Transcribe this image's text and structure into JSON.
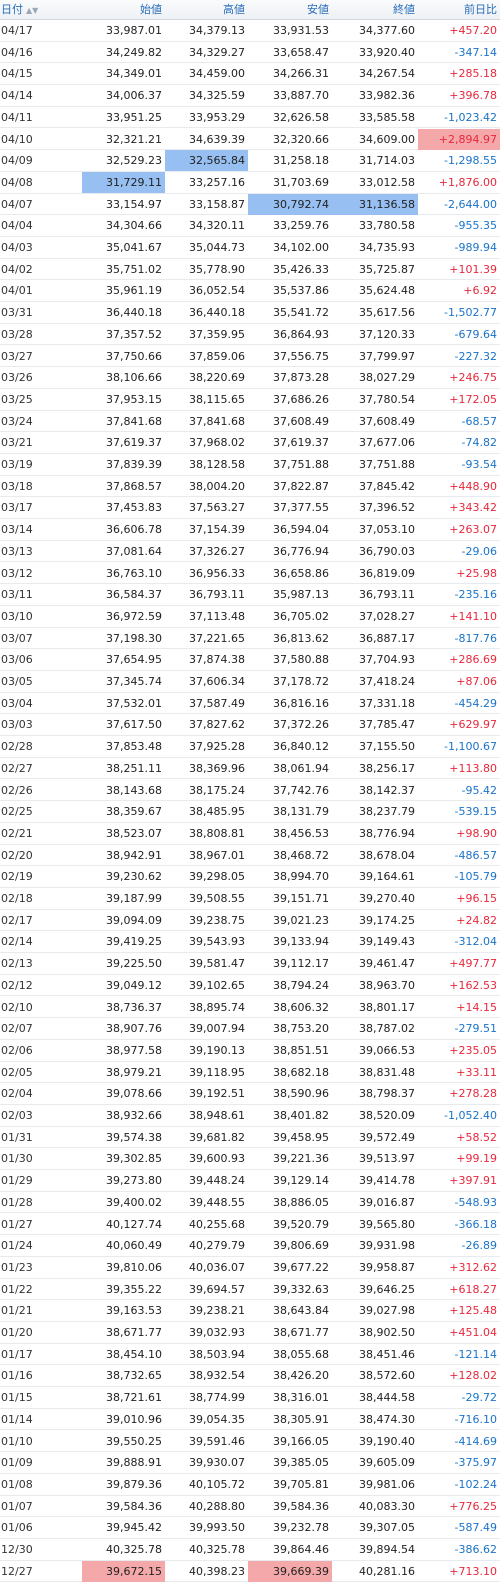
{
  "header": {
    "date": "日付",
    "open": "始値",
    "high": "高値",
    "low": "安値",
    "close": "終値",
    "change": "前日比"
  },
  "colors": {
    "positive": "#e8283c",
    "negative": "#1a73c8",
    "highlight_blue": "#97bff2",
    "highlight_red": "#f5a8aa"
  },
  "rows": [
    [
      "04/17",
      "33,987.01",
      "34,379.13",
      "33,931.53",
      "34,377.60",
      "+457.20"
    ],
    [
      "04/16",
      "34,249.82",
      "34,329.27",
      "33,658.47",
      "33,920.40",
      "-347.14"
    ],
    [
      "04/15",
      "34,349.01",
      "34,459.00",
      "34,266.31",
      "34,267.54",
      "+285.18"
    ],
    [
      "04/14",
      "34,006.37",
      "34,325.59",
      "33,887.70",
      "33,982.36",
      "+396.78"
    ],
    [
      "04/11",
      "33,951.25",
      "33,953.29",
      "32,626.58",
      "33,585.58",
      "-1,023.42"
    ],
    [
      "04/10",
      "32,321.21",
      "34,639.39",
      "32,320.66",
      "34,609.00",
      "+2,894.97"
    ],
    [
      "04/09",
      "32,529.23",
      "32,565.84",
      "31,258.18",
      "31,714.03",
      "-1,298.55"
    ],
    [
      "04/08",
      "31,729.11",
      "33,257.16",
      "31,703.69",
      "33,012.58",
      "+1,876.00"
    ],
    [
      "04/07",
      "33,154.97",
      "33,158.87",
      "30,792.74",
      "31,136.58",
      "-2,644.00"
    ],
    [
      "04/04",
      "34,304.66",
      "34,320.11",
      "33,259.76",
      "33,780.58",
      "-955.35"
    ],
    [
      "04/03",
      "35,041.67",
      "35,044.73",
      "34,102.00",
      "34,735.93",
      "-989.94"
    ],
    [
      "04/02",
      "35,751.02",
      "35,778.90",
      "35,426.33",
      "35,725.87",
      "+101.39"
    ],
    [
      "04/01",
      "35,961.19",
      "36,052.54",
      "35,537.86",
      "35,624.48",
      "+6.92"
    ],
    [
      "03/31",
      "36,440.18",
      "36,440.18",
      "35,541.72",
      "35,617.56",
      "-1,502.77"
    ],
    [
      "03/28",
      "37,357.52",
      "37,359.95",
      "36,864.93",
      "37,120.33",
      "-679.64"
    ],
    [
      "03/27",
      "37,750.66",
      "37,859.06",
      "37,556.75",
      "37,799.97",
      "-227.32"
    ],
    [
      "03/26",
      "38,106.66",
      "38,220.69",
      "37,873.28",
      "38,027.29",
      "+246.75"
    ],
    [
      "03/25",
      "37,953.15",
      "38,115.65",
      "37,686.26",
      "37,780.54",
      "+172.05"
    ],
    [
      "03/24",
      "37,841.68",
      "37,841.68",
      "37,608.49",
      "37,608.49",
      "-68.57"
    ],
    [
      "03/21",
      "37,619.37",
      "37,968.02",
      "37,619.37",
      "37,677.06",
      "-74.82"
    ],
    [
      "03/19",
      "37,839.39",
      "38,128.58",
      "37,751.88",
      "37,751.88",
      "-93.54"
    ],
    [
      "03/18",
      "37,868.57",
      "38,004.20",
      "37,822.87",
      "37,845.42",
      "+448.90"
    ],
    [
      "03/17",
      "37,453.83",
      "37,563.27",
      "37,377.55",
      "37,396.52",
      "+343.42"
    ],
    [
      "03/14",
      "36,606.78",
      "37,154.39",
      "36,594.04",
      "37,053.10",
      "+263.07"
    ],
    [
      "03/13",
      "37,081.64",
      "37,326.27",
      "36,776.94",
      "36,790.03",
      "-29.06"
    ],
    [
      "03/12",
      "36,763.10",
      "36,956.33",
      "36,658.86",
      "36,819.09",
      "+25.98"
    ],
    [
      "03/11",
      "36,584.37",
      "36,793.11",
      "35,987.13",
      "36,793.11",
      "-235.16"
    ],
    [
      "03/10",
      "36,972.59",
      "37,113.48",
      "36,705.02",
      "37,028.27",
      "+141.10"
    ],
    [
      "03/07",
      "37,198.30",
      "37,221.65",
      "36,813.62",
      "36,887.17",
      "-817.76"
    ],
    [
      "03/06",
      "37,654.95",
      "37,874.38",
      "37,580.88",
      "37,704.93",
      "+286.69"
    ],
    [
      "03/05",
      "37,345.74",
      "37,606.34",
      "37,178.72",
      "37,418.24",
      "+87.06"
    ],
    [
      "03/04",
      "37,532.01",
      "37,587.49",
      "36,816.16",
      "37,331.18",
      "-454.29"
    ],
    [
      "03/03",
      "37,617.50",
      "37,827.62",
      "37,372.26",
      "37,785.47",
      "+629.97"
    ],
    [
      "02/28",
      "37,853.48",
      "37,925.28",
      "36,840.12",
      "37,155.50",
      "-1,100.67"
    ],
    [
      "02/27",
      "38,251.11",
      "38,369.96",
      "38,061.94",
      "38,256.17",
      "+113.80"
    ],
    [
      "02/26",
      "38,143.68",
      "38,175.24",
      "37,742.76",
      "38,142.37",
      "-95.42"
    ],
    [
      "02/25",
      "38,359.67",
      "38,485.95",
      "38,131.79",
      "38,237.79",
      "-539.15"
    ],
    [
      "02/21",
      "38,523.07",
      "38,808.81",
      "38,456.53",
      "38,776.94",
      "+98.90"
    ],
    [
      "02/20",
      "38,942.91",
      "38,967.01",
      "38,468.72",
      "38,678.04",
      "-486.57"
    ],
    [
      "02/19",
      "39,230.62",
      "39,298.05",
      "38,994.70",
      "39,164.61",
      "-105.79"
    ],
    [
      "02/18",
      "39,187.99",
      "39,508.55",
      "39,151.71",
      "39,270.40",
      "+96.15"
    ],
    [
      "02/17",
      "39,094.09",
      "39,238.75",
      "39,021.23",
      "39,174.25",
      "+24.82"
    ],
    [
      "02/14",
      "39,419.25",
      "39,543.93",
      "39,133.94",
      "39,149.43",
      "-312.04"
    ],
    [
      "02/13",
      "39,225.50",
      "39,581.47",
      "39,112.17",
      "39,461.47",
      "+497.77"
    ],
    [
      "02/12",
      "39,049.12",
      "39,102.65",
      "38,794.24",
      "38,963.70",
      "+162.53"
    ],
    [
      "02/10",
      "38,736.37",
      "38,895.74",
      "38,606.32",
      "38,801.17",
      "+14.15"
    ],
    [
      "02/07",
      "38,907.76",
      "39,007.94",
      "38,753.20",
      "38,787.02",
      "-279.51"
    ],
    [
      "02/06",
      "38,977.58",
      "39,190.13",
      "38,851.51",
      "39,066.53",
      "+235.05"
    ],
    [
      "02/05",
      "38,979.21",
      "39,118.95",
      "38,682.18",
      "38,831.48",
      "+33.11"
    ],
    [
      "02/04",
      "39,078.66",
      "39,192.51",
      "38,590.96",
      "38,798.37",
      "+278.28"
    ],
    [
      "02/03",
      "38,932.66",
      "38,948.61",
      "38,401.82",
      "38,520.09",
      "-1,052.40"
    ],
    [
      "01/31",
      "39,574.38",
      "39,681.82",
      "39,458.95",
      "39,572.49",
      "+58.52"
    ],
    [
      "01/30",
      "39,302.85",
      "39,600.93",
      "39,221.36",
      "39,513.97",
      "+99.19"
    ],
    [
      "01/29",
      "39,273.80",
      "39,448.24",
      "39,129.14",
      "39,414.78",
      "+397.91"
    ],
    [
      "01/28",
      "39,400.02",
      "39,448.55",
      "38,886.05",
      "39,016.87",
      "-548.93"
    ],
    [
      "01/27",
      "40,127.74",
      "40,255.68",
      "39,520.79",
      "39,565.80",
      "-366.18"
    ],
    [
      "01/24",
      "40,060.49",
      "40,279.79",
      "39,806.69",
      "39,931.98",
      "-26.89"
    ],
    [
      "01/23",
      "39,810.06",
      "40,036.07",
      "39,677.22",
      "39,958.87",
      "+312.62"
    ],
    [
      "01/22",
      "39,355.22",
      "39,694.57",
      "39,332.63",
      "39,646.25",
      "+618.27"
    ],
    [
      "01/21",
      "39,163.53",
      "39,238.21",
      "38,643.84",
      "39,027.98",
      "+125.48"
    ],
    [
      "01/20",
      "38,671.77",
      "39,032.93",
      "38,671.77",
      "38,902.50",
      "+451.04"
    ],
    [
      "01/17",
      "38,454.10",
      "38,503.94",
      "38,055.68",
      "38,451.46",
      "-121.14"
    ],
    [
      "01/16",
      "38,732.65",
      "38,932.54",
      "38,426.20",
      "38,572.60",
      "+128.02"
    ],
    [
      "01/15",
      "38,721.61",
      "38,774.99",
      "38,316.01",
      "38,444.58",
      "-29.72"
    ],
    [
      "01/14",
      "39,010.96",
      "39,054.35",
      "38,305.91",
      "38,474.30",
      "-716.10"
    ],
    [
      "01/10",
      "39,550.25",
      "39,591.46",
      "39,166.05",
      "39,190.40",
      "-414.69"
    ],
    [
      "01/09",
      "39,888.91",
      "39,930.07",
      "39,385.05",
      "39,605.09",
      "-375.97"
    ],
    [
      "01/08",
      "39,879.36",
      "40,105.72",
      "39,705.81",
      "39,981.06",
      "-102.24"
    ],
    [
      "01/07",
      "39,584.36",
      "40,288.80",
      "39,584.36",
      "40,083.30",
      "+776.25"
    ],
    [
      "01/06",
      "39,945.42",
      "39,993.50",
      "39,232.78",
      "39,307.05",
      "-587.49"
    ],
    [
      "12/30",
      "40,325.78",
      "40,325.78",
      "39,864.46",
      "39,894.54",
      "-386.62"
    ],
    [
      "12/27",
      "39,672.15",
      "40,398.23",
      "39,669.39",
      "40,281.16",
      "+713.10"
    ]
  ],
  "highlights": [
    {
      "row": 5,
      "col": 5,
      "type": "red"
    },
    {
      "row": 6,
      "col": 2,
      "type": "blue"
    },
    {
      "row": 7,
      "col": 1,
      "type": "blue"
    },
    {
      "row": 8,
      "col": 3,
      "type": "blue"
    },
    {
      "row": 8,
      "col": 4,
      "type": "blue"
    },
    {
      "row": 71,
      "col": 1,
      "type": "red"
    },
    {
      "row": 71,
      "col": 3,
      "type": "red"
    },
    {
      "row": 72,
      "col": 2,
      "type": "red"
    },
    {
      "row": 72,
      "col": 4,
      "type": "red"
    }
  ]
}
